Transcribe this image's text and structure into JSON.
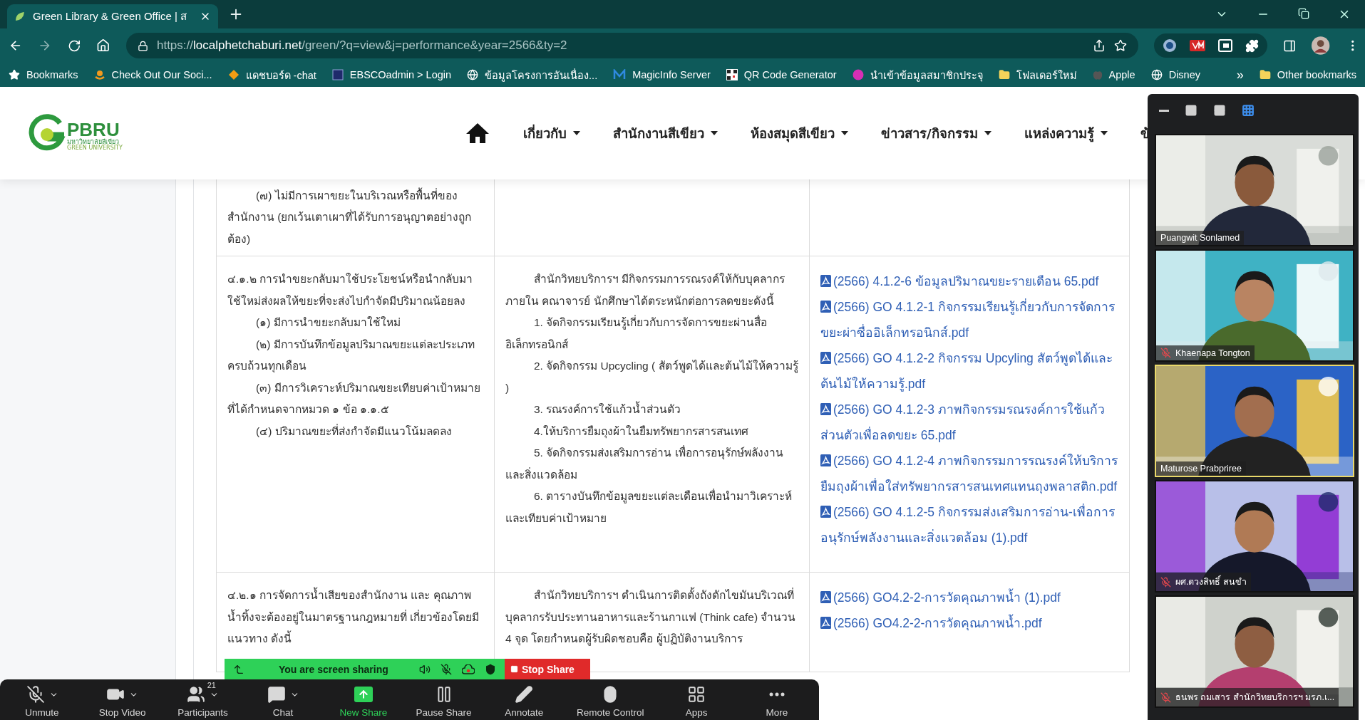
{
  "browser": {
    "tabs": [
      {
        "title": "Green Library & Green Office | ส",
        "selected": true
      }
    ],
    "address": {
      "scheme": "https://",
      "host": "localphetchaburi.net",
      "path": "/green/?q=view&j=performance&year=2566&ty=2"
    },
    "bookmarks": [
      {
        "label": "Bookmarks",
        "kind": "star"
      },
      {
        "label": "Check Out Our Soci...",
        "kind": "arc"
      },
      {
        "label": "แดชบอร์ด -chat",
        "kind": "diamond"
      },
      {
        "label": "EBSCOadmin > Login",
        "kind": "square"
      },
      {
        "label": "ข้อมูลโครงการอันเนื่อง...",
        "kind": "globe"
      },
      {
        "label": "MagicInfo Server",
        "kind": "zigzag"
      },
      {
        "label": "QR Code Generator",
        "kind": "qr"
      },
      {
        "label": "นำเข้าข้อมูลสมาชิกประจุ",
        "kind": "circle"
      },
      {
        "label": "โฟลเดอร์ใหม่",
        "kind": "folder"
      },
      {
        "label": "Apple",
        "kind": "apple"
      },
      {
        "label": "Disney",
        "kind": "globe"
      }
    ],
    "bookmarks_more": "»",
    "other_bookmarks": "Other bookmarks"
  },
  "site_header": {
    "logo": {
      "mark": "PBRU",
      "subtitle": "มหาวิทยาลัยสีเขียว",
      "tagline": "GREEN UNIVERSITY"
    },
    "nav": [
      {
        "label": "เกี่ยวกับ",
        "has_menu": true
      },
      {
        "label": "สำนักงานสีเขียว",
        "has_menu": true
      },
      {
        "label": "ห้องสมุดสีเขียว",
        "has_menu": true
      },
      {
        "label": "ข่าวสาร/กิจกรรม",
        "has_menu": true
      },
      {
        "label": "แหล่งความรู้",
        "has_menu": true
      },
      {
        "label": "ข้",
        "has_menu": false
      }
    ]
  },
  "table": {
    "rows": [
      {
        "criterion": [
          {
            "text": "(๗) ไม่มีการเผาขยะในบริเวณหรือพื้นที่ของสำนักงาน (ยกเว้นเตาเผาที่ได้รับการอนุญาตอย่างถูกต้อง)",
            "indent": true
          }
        ],
        "action": [],
        "files": []
      },
      {
        "criterion": [
          {
            "text": "๔.๑.๒ การนำขยะกลับมาใช้ประโยชน์หรือนำกลับมาใช้ใหม่ส่งผลให้ขยะที่จะส่งไปกำจัดมีปริมาณน้อยลง",
            "indent": false
          },
          {
            "text": "(๑) มีการนำขยะกลับมาใช้ใหม่",
            "indent": true
          },
          {
            "text": "(๒) มีการบันทึกข้อมูลปริมาณขยะแต่ละประเภท ครบถ้วนทุกเดือน",
            "indent": true
          },
          {
            "text": "(๓) มีการวิเคราะห์ปริมาณขยะเทียบค่าเป้าหมายที่ได้กำหนดจากหมวด ๑ ข้อ ๑.๑.๕",
            "indent": true
          },
          {
            "text": "(๔) ปริมาณขยะที่ส่งกำจัดมีแนวโน้มลดลง",
            "indent": true
          }
        ],
        "action": [
          {
            "text": "สำนักวิทยบริการฯ มีกิจกรรมการรณรงค์ให้กับบุคลากรภายใน คณาจารย์ นักศึกษาได้ตระหนักต่อการลดขยะดังนี้",
            "indent": true
          },
          {
            "text": "1. จัดกิจกรรมเรียนรู้เกี่ยวกับการจัดการขยะผ่านสื่ออิเล็กทรอนิกส์",
            "indent": true
          },
          {
            "text": "2. จัดกิจกรรม Upcycling ( สัตว์พูดได้และต้นไม้ให้ความรู้ )",
            "indent": true
          },
          {
            "text": "3. รณรงค์การใช้แก้วน้ำส่วนตัว",
            "indent": true
          },
          {
            "text": "4.ให้บริการยืมถุงผ้าในยืมทรัพยากรสารสนเทศ",
            "indent": true
          },
          {
            "text": "5. จัดกิจกรรมส่งเสริมการอ่าน เพื่อการอนุรักษ์พลังงานและสิ่งแวดล้อม",
            "indent": true
          },
          {
            "text": "6. ตารางบันทึกข้อมูลขยะแต่ละเดือนเพื่อนำมาวิเคราะห์และเทียบค่าเป้าหมาย",
            "indent": true
          }
        ],
        "files": [
          "(2566) 4.1.2-6 ข้อมูลปริมาณขยะรายเดือน 65.pdf",
          "(2566) GO 4.1.2-1 กิจกรรมเรียนรู้เกี่ยวกับการจัดการขยะผ่าซื่ออิเล็กทรอนิกส์.pdf",
          "(2566) GO 4.1.2-2 กิจกรรม Upcyling สัตว์พูดได้และต้นไม้ให้ความรู้.pdf",
          "(2566) GO 4.1.2-3 ภาพกิจกรรมรณรงค์การใช้แก้วส่วนตัวเพื่อลดขยะ 65.pdf",
          "(2566) GO 4.1.2-4 ภาพกิจกรรมการรณรงค์ให้บริการยืมถุงผ้าเพื่อใส่ทรัพยากรสารสนเทศแทนถุงพลาสติก.pdf",
          "(2566) GO 4.1.2-5 กิจกรรมส่งเสริมการอ่าน-เพื่อการอนุรักษ์พลังงานและสิ่งแวดล้อม (1).pdf"
        ]
      },
      {
        "criterion": [
          {
            "text": "๔.๒.๑ การจัดการน้ำเสียของสำนักงาน และ คุณภาพน้ำทิ้งจะต้องอยู่ในมาตรฐานกฎหมายที่ เกี่ยวข้องโดยมีแนวทาง ดังนี้",
            "indent": false
          }
        ],
        "action": [
          {
            "text": "สำนักวิทยบริการฯ ดำเนินการติดตั้งถังดักไขมันบริเวณที่บุคลากรรับประทานอาหารและร้านกาแฟ (Think cafe) จำนวน 4 จุด โดยกำหนดผู้รับผิดชอบคือ ผู้ปฏิบัติงานบริการ",
            "indent": true
          }
        ],
        "files": [
          "(2566) GO4.2-2-การวัดคุณภาพน้ำ (1).pdf",
          "(2566) GO4.2-2-การวัดคุณภาพน้ำ.pdf"
        ]
      }
    ]
  },
  "zoom": {
    "share_bar": {
      "status": "You are screen sharing",
      "stop": "Stop Share"
    },
    "toolbar": [
      {
        "label": "Unmute",
        "kind": "mic-off",
        "has_menu": true,
        "accent": false
      },
      {
        "label": "Stop Video",
        "kind": "video",
        "has_menu": true,
        "accent": false
      },
      {
        "label": "Participants",
        "kind": "users",
        "has_menu": true,
        "accent": false,
        "count": "21"
      },
      {
        "label": "Chat",
        "kind": "chat",
        "has_menu": true,
        "accent": false
      },
      {
        "label": "New Share",
        "kind": "share",
        "has_menu": false,
        "accent": true
      },
      {
        "label": "Pause Share",
        "kind": "pause",
        "has_menu": false,
        "accent": false
      },
      {
        "label": "Annotate",
        "kind": "pen",
        "has_menu": false,
        "accent": false
      },
      {
        "label": "Remote Control",
        "kind": "mouse",
        "has_menu": false,
        "accent": false
      },
      {
        "label": "Apps",
        "kind": "apps",
        "has_menu": false,
        "accent": false
      },
      {
        "label": "More",
        "kind": "more",
        "has_menu": false,
        "accent": false
      }
    ],
    "views": [
      {
        "kind": "minimize",
        "selected": false
      },
      {
        "kind": "speaker",
        "selected": false
      },
      {
        "kind": "strip",
        "selected": false
      },
      {
        "kind": "grid",
        "selected": true
      }
    ],
    "tiles": [
      {
        "name": "Puangwit Sonlamed",
        "muted": false,
        "speaking": false
      },
      {
        "name": "Khaenapa Tongton",
        "muted": true,
        "speaking": false
      },
      {
        "name": "Maturose Prabpriree",
        "muted": false,
        "speaking": true
      },
      {
        "name": "ผศ.ตวงสิทธิ์ สนขำ",
        "muted": true,
        "speaking": false
      },
      {
        "name": "ธนพร  ถมเสาร สำนักวิทยบริการฯ มรภ.เ...",
        "muted": true,
        "speaking": false
      }
    ]
  }
}
